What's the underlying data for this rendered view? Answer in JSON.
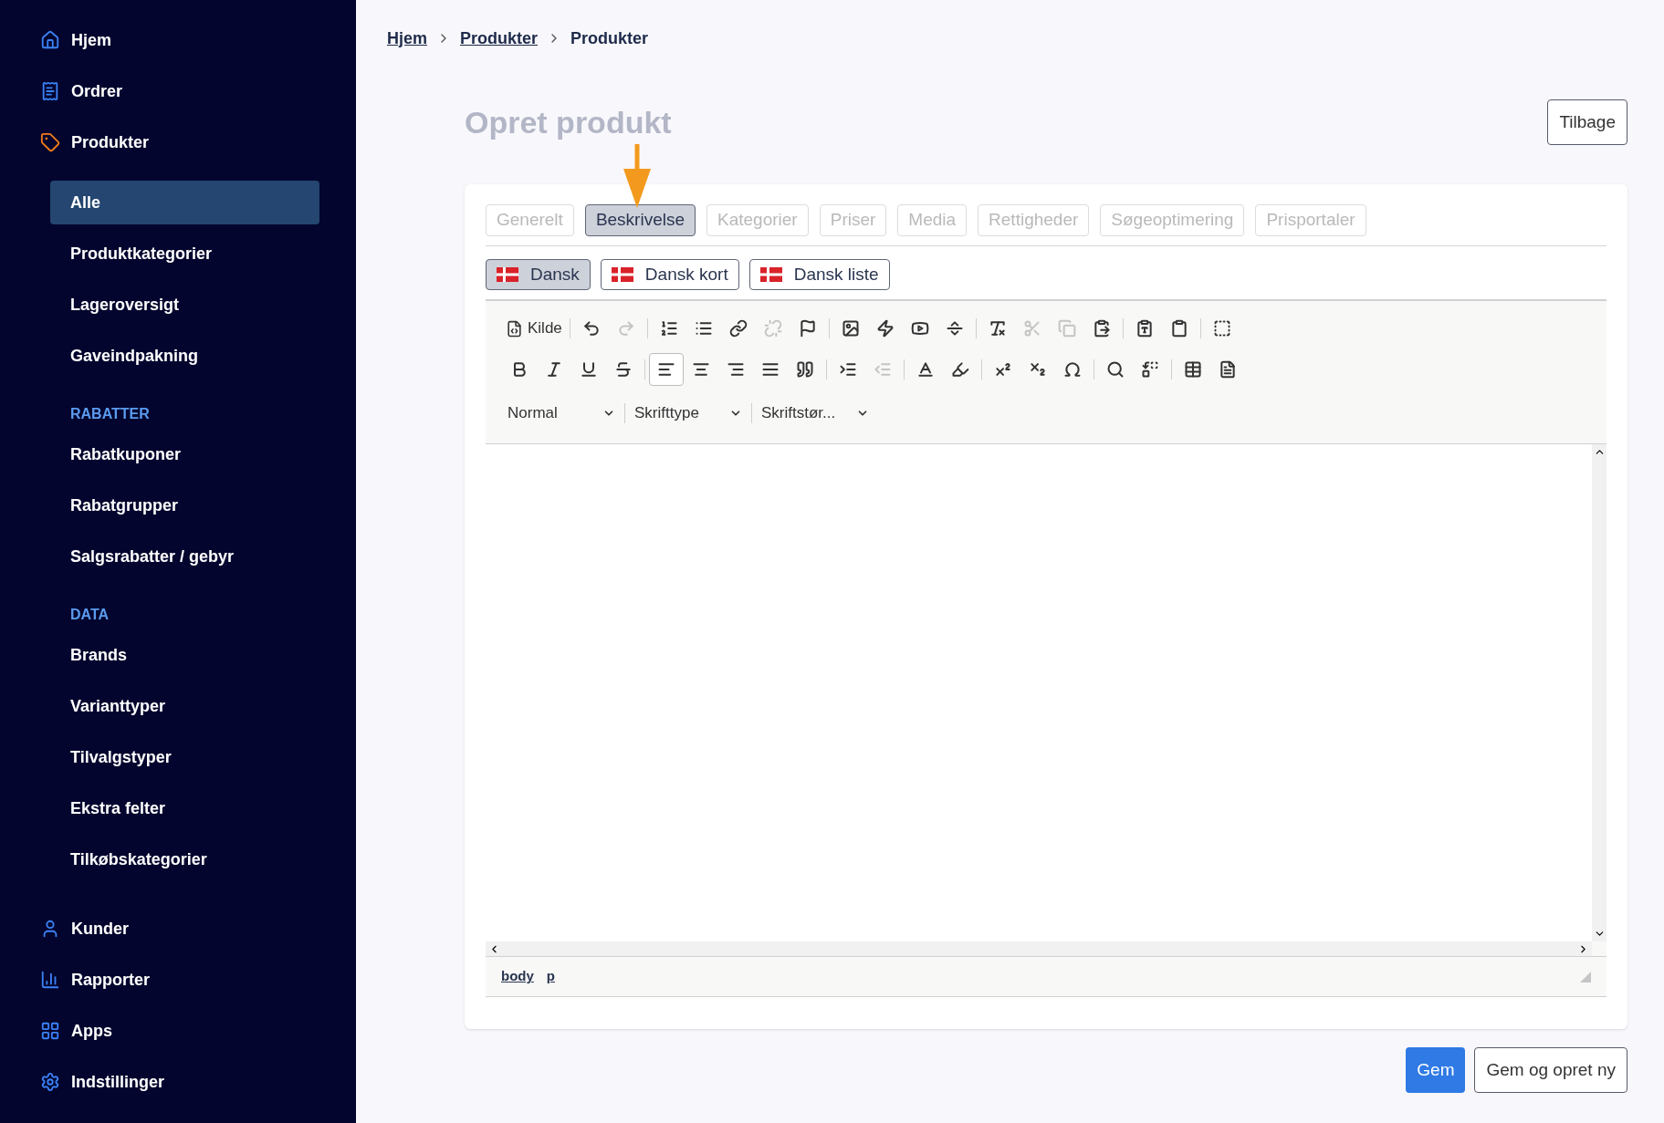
{
  "sidebar": {
    "top": [
      {
        "kind": "home",
        "label": "Hjem"
      },
      {
        "kind": "orders",
        "label": "Ordrer"
      },
      {
        "kind": "tag",
        "label": "Produkter",
        "children": [
          {
            "label": "Alle",
            "selected": true
          },
          {
            "label": "Produktkategorier",
            "selected": false
          },
          {
            "label": "Lageroversigt",
            "selected": false
          },
          {
            "label": "Gaveindpakning",
            "selected": false
          }
        ]
      }
    ],
    "sections": [
      {
        "heading": "RABATTER",
        "items": [
          {
            "label": "Rabatkuponer",
            "selected": false
          },
          {
            "label": "Rabatgrupper",
            "selected": false
          },
          {
            "label": "Salgsrabatter / gebyr",
            "selected": false
          }
        ]
      },
      {
        "heading": "DATA",
        "items": [
          {
            "label": "Brands",
            "selected": false
          },
          {
            "label": "Varianttyper",
            "selected": false
          },
          {
            "label": "Tilvalgstyper",
            "selected": false
          },
          {
            "label": "Ekstra felter",
            "selected": false
          },
          {
            "label": "Tilkøbskategorier",
            "selected": false
          }
        ]
      }
    ],
    "bottom": [
      {
        "kind": "user",
        "label": "Kunder"
      },
      {
        "kind": "chart",
        "label": "Rapporter"
      },
      {
        "kind": "apps",
        "label": "Apps"
      },
      {
        "kind": "settings",
        "label": "Indstillinger"
      }
    ]
  },
  "breadcrumb": [
    {
      "label": "Hjem",
      "link": true
    },
    {
      "label": "Produkter",
      "link": true
    },
    {
      "label": "Produkter",
      "link": false
    }
  ],
  "title": "Opret produkt",
  "back_button": "Tilbage",
  "tabs": [
    {
      "label": "Generelt",
      "selected": false
    },
    {
      "label": "Beskrivelse",
      "selected": true
    },
    {
      "label": "Kategorier",
      "selected": false
    },
    {
      "label": "Priser",
      "selected": false
    },
    {
      "label": "Media",
      "selected": false
    },
    {
      "label": "Rettigheder",
      "selected": false
    },
    {
      "label": "Søgeoptimering",
      "selected": false
    },
    {
      "label": "Prisportaler",
      "selected": false
    }
  ],
  "languages": [
    {
      "label": "Dansk",
      "selected": true
    },
    {
      "label": "Dansk kort",
      "selected": false
    },
    {
      "label": "Dansk liste",
      "selected": false
    }
  ],
  "editor": {
    "source_button": "Kilde",
    "toolbar_rows": [
      [
        [
          {
            "kind": "undo",
            "disabled": false
          },
          {
            "kind": "redo",
            "disabled": true
          }
        ],
        [
          {
            "kind": "ol",
            "disabled": false
          },
          {
            "kind": "ul",
            "disabled": false
          },
          {
            "kind": "link",
            "disabled": false
          },
          {
            "kind": "unlink",
            "disabled": true
          },
          {
            "kind": "flag",
            "disabled": false
          }
        ],
        [
          {
            "kind": "image",
            "disabled": false
          },
          {
            "kind": "flash",
            "disabled": false
          },
          {
            "kind": "video",
            "disabled": false
          },
          {
            "kind": "hr",
            "disabled": false
          }
        ],
        [
          {
            "kind": "clearformat",
            "disabled": false
          },
          {
            "kind": "cut",
            "disabled": true
          },
          {
            "kind": "copy",
            "disabled": true
          },
          {
            "kind": "paste",
            "disabled": false
          }
        ],
        [
          {
            "kind": "pastetext",
            "disabled": false
          },
          {
            "kind": "pasteword",
            "disabled": false
          }
        ],
        [
          {
            "kind": "blocks",
            "disabled": false
          }
        ]
      ],
      [
        [
          {
            "kind": "bold",
            "on": false
          },
          {
            "kind": "italic",
            "on": false
          },
          {
            "kind": "underline",
            "on": false
          },
          {
            "kind": "strike",
            "on": false
          }
        ],
        [
          {
            "kind": "alignleft",
            "on": true
          },
          {
            "kind": "aligncenter",
            "on": false
          },
          {
            "kind": "alignright",
            "on": false
          },
          {
            "kind": "justify",
            "on": false
          },
          {
            "kind": "quote",
            "on": false
          }
        ],
        [
          {
            "kind": "indent",
            "disabled": false
          },
          {
            "kind": "outdent",
            "disabled": true
          }
        ],
        [
          {
            "kind": "textcolor",
            "on": false
          },
          {
            "kind": "bgcolor",
            "on": false
          }
        ],
        [
          {
            "kind": "sup",
            "on": false
          },
          {
            "kind": "sub",
            "on": false
          },
          {
            "kind": "omega",
            "on": false
          }
        ],
        [
          {
            "kind": "search",
            "on": false
          },
          {
            "kind": "replace",
            "on": false
          }
        ],
        [
          {
            "kind": "table",
            "on": false
          },
          {
            "kind": "page",
            "on": false
          }
        ]
      ]
    ],
    "combos": [
      "Normal",
      "Skrifttype",
      "Skriftstør..."
    ],
    "path": [
      "body",
      "p"
    ]
  },
  "actions": [
    {
      "label": "Gem",
      "kind": "primary"
    },
    {
      "label": "Gem og opret ny",
      "kind": "secondary"
    }
  ]
}
